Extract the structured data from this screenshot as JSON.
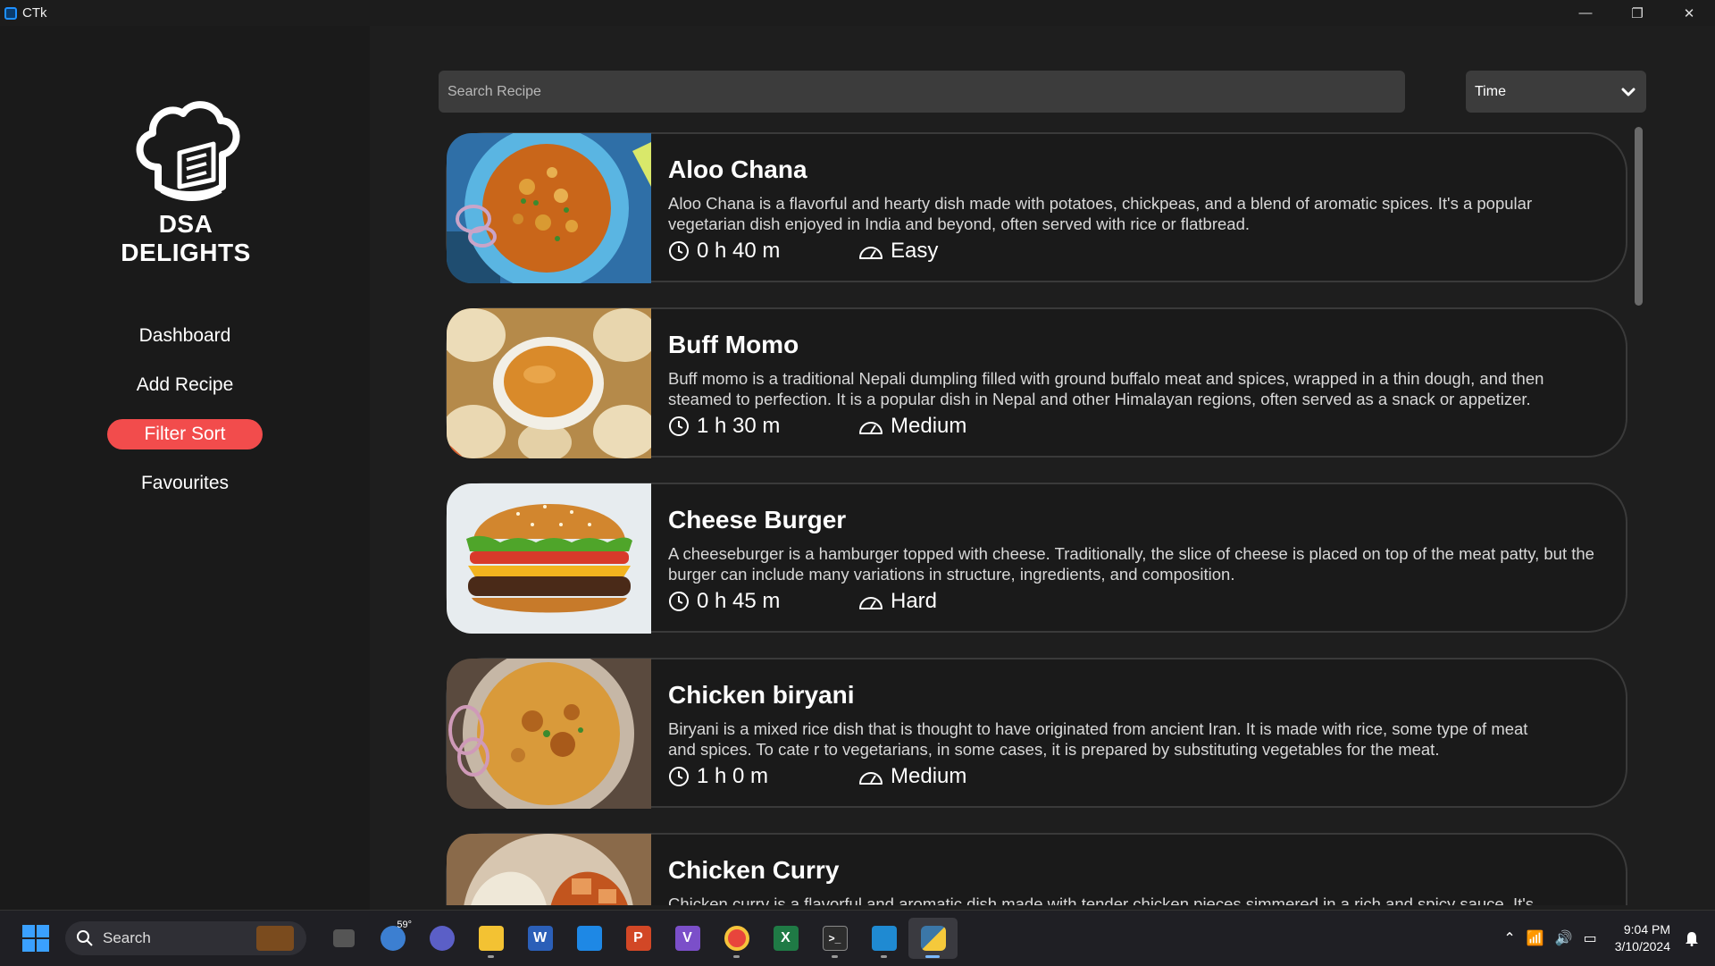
{
  "window": {
    "title": "CTk",
    "minimize": "—",
    "restore": "❐",
    "close": "✕"
  },
  "sidebar": {
    "brand": "DSA DELIGHTS",
    "nav": [
      {
        "label": "Dashboard",
        "active": false
      },
      {
        "label": "Add Recipe",
        "active": false
      },
      {
        "label": "Filter Sort",
        "active": true
      },
      {
        "label": "Favourites",
        "active": false
      }
    ]
  },
  "main": {
    "search_placeholder": "Search Recipe",
    "sort": {
      "selected": "Time"
    },
    "recipes": [
      {
        "title": "Aloo Chana",
        "description": "Aloo Chana is a flavorful and hearty dish made with potatoes, chickpeas, and a blend of aromatic spices. It's a popular vegetarian dish enjoyed in India and beyond, often served with rice or flatbread.",
        "time": "0 h 40 m",
        "difficulty": "Easy"
      },
      {
        "title": "Buff Momo",
        "description": "Buff momo is a traditional Nepali dumpling filled with ground buffalo meat and spices, wrapped in a thin dough, and then steamed to perfection. It is a popular dish in Nepal and other Himalayan regions, often served as a snack or appetizer.",
        "time": "1 h 30 m",
        "difficulty": "Medium"
      },
      {
        "title": "Cheese Burger",
        "description": "A cheeseburger is a hamburger topped with cheese. Traditionally, the slice of cheese is placed on top of the meat patty, but the burger can include many variations in structure, ingredients, and composition.",
        "time": "0 h 45 m",
        "difficulty": "Hard"
      },
      {
        "title": "Chicken biryani",
        "description": "Biryani is a mixed rice dish that is thought to have originated from ancient Iran. It is made with rice, some type of meat and spices. To cate r to vegetarians, in some cases, it is prepared by substituting vegetables for the meat.",
        "time": "1 h 0 m",
        "difficulty": "Medium"
      },
      {
        "title": "Chicken Curry",
        "description": "Chicken curry is a flavorful and aromatic dish made with tender chicken pieces simmered in a rich and spicy sauce. It's",
        "time": "",
        "difficulty": ""
      }
    ]
  },
  "taskbar": {
    "search_label": "Search",
    "weather_temp": "59°",
    "clock_time": "9:04 PM",
    "clock_date": "3/10/2024"
  }
}
